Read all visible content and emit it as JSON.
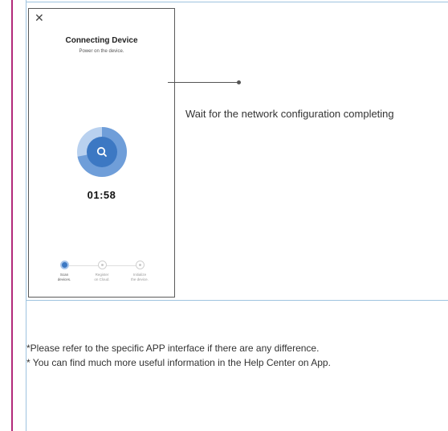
{
  "phone": {
    "title": "Connecting Device",
    "subtitle": "Power on the device.",
    "progress": 0.72,
    "timer": "01:58",
    "steps": [
      {
        "label": "Scan\ndevices.",
        "active": true
      },
      {
        "label": "Register\non Cloud.",
        "active": false
      },
      {
        "label": "Initialize\nthe device.",
        "active": false
      }
    ]
  },
  "callout": {
    "text": "Wait for the network configuration  completing"
  },
  "notes": [
    "*Please refer to the specific APP interface if there are any difference.",
    "* You can find much more useful information in the Help Center on App."
  ],
  "colors": {
    "accent": "#3c78c3",
    "accent_light": "#a8c5ea",
    "frame": "#9ec3df",
    "margin_line": "#b22a7a"
  }
}
